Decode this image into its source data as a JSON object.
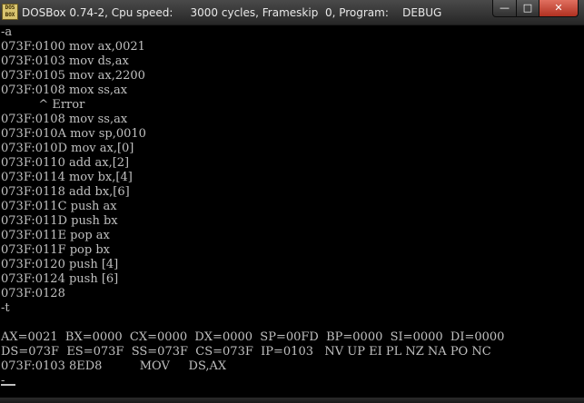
{
  "window": {
    "title": "DOSBox 0.74-2, Cpu speed:     3000 cycles, Frameskip  0, Program:    DEBUG",
    "icon_label": "DOS BOX",
    "buttons": {
      "minimize": "—",
      "maximize": "□",
      "close": "✕"
    }
  },
  "console": {
    "lines": [
      "-a",
      "073F:0100 mov ax,0021",
      "073F:0103 mov ds,ax",
      "073F:0105 mov ax,2200",
      "073F:0108 mox ss,ax",
      "          ^ Error",
      "073F:0108 mov ss,ax",
      "073F:010A mov sp,0010",
      "073F:010D mov ax,[0]",
      "073F:0110 add ax,[2]",
      "073F:0114 mov bx,[4]",
      "073F:0118 add bx,[6]",
      "073F:011C push ax",
      "073F:011D push bx",
      "073F:011E pop ax",
      "073F:011F pop bx",
      "073F:0120 push [4]",
      "073F:0124 push [6]",
      "073F:0128",
      "-t",
      "",
      "AX=0021  BX=0000  CX=0000  DX=0000  SP=00FD  BP=0000  SI=0000  DI=0000",
      "DS=073F  ES=073F  SS=073F  CS=073F  IP=0103   NV UP EI PL NZ NA PO NC",
      "073F:0103 8ED8          MOV     DS,AX",
      "-"
    ]
  },
  "colors": {
    "background": "#000000",
    "text": "#c0c0c0",
    "titlebar": "#303030",
    "close_button": "#c84030"
  }
}
